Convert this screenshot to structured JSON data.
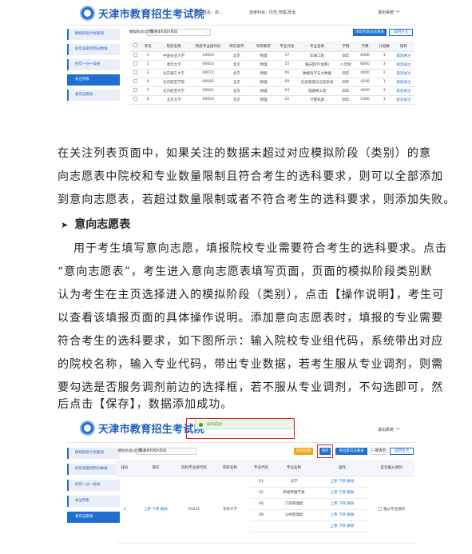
{
  "site_title": "天津市教育招生考试院",
  "shot1": {
    "header": {
      "candidate_label": "考生姓名：",
      "candidate_name": "高...",
      "subject_label": "选考科目：",
      "subjects": "历史,地理,政治",
      "logout": "退出系统"
    },
    "sidebar": [
      "模拟阶段计划查询",
      "往年录取控制分数线",
      "往年一分一段表",
      "关注列表",
      "意向志愿表"
    ],
    "active_sidebar_index": 3,
    "filter_label": "模拟阶段(类别)",
    "filter_value": "普通本科批A阶段",
    "add_button": "添加至意向志愿表",
    "back_button": "返回主页",
    "columns": [
      "",
      "序号",
      "院校名称",
      "院校专业组代码",
      "所在省市",
      "科目要求",
      "专业代号",
      "专业名称",
      "学制",
      "学费",
      "计划数",
      "操作"
    ],
    "rows": [
      [
        "1",
        "中国农业大学",
        "10003",
        "北京",
        "物理",
        "17",
        "车辆工程",
        "四年",
        "6000",
        "3",
        "取消关注"
      ],
      [
        "2",
        "清华大学",
        "00003",
        "北京",
        "物理",
        "15",
        "临床医学(协和)",
        "八年制",
        "6000",
        "3",
        "取消关注"
      ],
      [
        "3",
        "北京理工大学",
        "00072",
        "北京",
        "物理",
        "06",
        "数据科学与大数据",
        "四年",
        "4000",
        "2",
        "取消关注"
      ],
      [
        "4",
        "北京航空学院",
        "00042",
        "北京",
        "物理",
        "09",
        "信息管理与信息系统",
        "四年",
        "4200",
        "1",
        "取消关注"
      ],
      [
        "5",
        "北京航空大学",
        "00621",
        "北京",
        "物理",
        "03",
        "电路网工程",
        "四年",
        "4000",
        "3",
        "取消关注"
      ],
      [
        "6",
        "北京大学",
        "00003",
        "北京",
        "物理",
        "22",
        "计算机类",
        "四年",
        "5300",
        "1",
        "取消关注"
      ]
    ]
  },
  "paragraph1": [
    "在关注列表页面中，如果关注的数据未超过对应模拟阶段（类别）的意",
    "向志愿表中院校和专业数量限制且符合考生的选科要求，则可以全部添加",
    "到意向志愿表，若超过数量限制或者不符合考生的选科要求，则添加失败。"
  ],
  "heading": {
    "arrow": "➤",
    "text": "意向志愿表"
  },
  "paragraph2": [
    "用于考生填写意向志愿，填报院校专业需要符合考生的选科要求。点击",
    "“意向志愿表”，考生进入意向志愿表填写页面，页面的模拟阶段类别默",
    "认为考生在主页选择进入的模拟阶段（类别），点击【操作说明】，考生可",
    "以查看该填报页面的具体操作说明。添加意向志愿表时，填报的专业需要",
    "符合考生的选科要求，如下图所示：输入院校专业组代码，系统带出对应",
    "的院校名称，输入专业代码，带出专业数据，若考生服从专业调剂，则需",
    "要勾选是否服务调剂前边的选择框，若不服从专业调剂，不勾选即可，然",
    "后点击【保存】，数据添加成功。"
  ],
  "shot2": {
    "toast": "操作成功!",
    "logout": "退出系统",
    "sidebar": [
      "模拟阶段计划查询",
      "往年录取控制分数线",
      "往年一分一段表",
      "关注列表",
      "意向志愿表"
    ],
    "active_sidebar_index": 4,
    "filter_label": "模拟阶段(类别)",
    "filter_value": "普通本科批A阶段",
    "buttons": {
      "instructions": "操作说明",
      "save": "保存",
      "export": "导出意向志愿表",
      "one_click": "一键清空",
      "back": "返回主页"
    },
    "columns": [
      "排号",
      "操作",
      "院校专业组代码",
      "院校名称",
      "专业代码",
      "专业名称",
      "操作",
      "是否服从调剂"
    ],
    "group_row": {
      "index": "1",
      "ops": "上移 下移 删除",
      "group_code": "01041",
      "school": "华侨大学",
      "adjust": "服从专业调剂"
    },
    "majors": [
      [
        "01",
        "法学",
        "上移 下移 删除"
      ],
      [
        "02",
        "新闻传播学类",
        "上移 下移 删除"
      ],
      [
        "04",
        "工商管理类",
        "上移 下移 删除"
      ],
      [
        "08",
        "公共管理类",
        "上移 下移 删除"
      ],
      [
        "",
        "",
        "上移 下移 删除"
      ]
    ]
  }
}
